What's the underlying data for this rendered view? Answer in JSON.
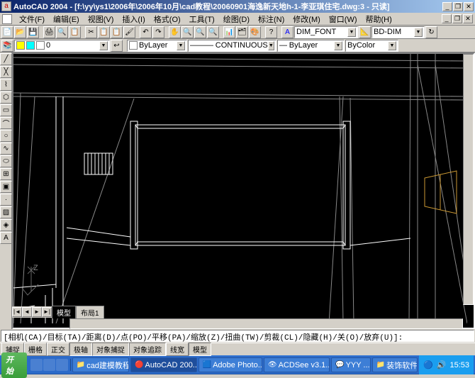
{
  "title": "AutoCAD 2004 - [f:\\yy\\ys1\\2006年\\2006年10月\\cad教程\\20060901海逸新天地h-1-李亚琪住宅.dwg:3 - 只读]",
  "appicon": "a",
  "menu": {
    "file": "文件(F)",
    "edit": "编辑(E)",
    "view": "视图(V)",
    "insert": "插入(I)",
    "format": "格式(O)",
    "tools": "工具(T)",
    "draw": "绘图(D)",
    "dimension": "标注(N)",
    "modify": "修改(M)",
    "window": "窗口(W)",
    "help": "帮助(H)"
  },
  "viewtabs": {
    "model": "模型",
    "layout1": "布局1"
  },
  "cmdline": "[相机(CA)/目标(TA)/距离(D)/点(PO)/平移(PA)/缩放(Z)/扭曲(TW)/剪裁(CL)/隐藏(H)/关(O)/放弃(U)]:",
  "status": {
    "snap": "捕捉",
    "grid": "栅格",
    "ortho": "正交",
    "polar": "极轴",
    "osnap": "对象捕捉",
    "otrack": "对象追踪",
    "lwt": "线宽",
    "model": "模型"
  },
  "task": {
    "start": "开始",
    "t1": "cad建模教程",
    "t2": "AutoCAD 200...",
    "t3": "Adobe Photo...",
    "t4": "ACDSee v3.1...",
    "t5": "YYY ...",
    "t6": "装饰软件",
    "time": "15:53"
  },
  "dropdowns": {
    "layer": "ByLayer",
    "continuous": "CONTINUOUS",
    "bylayer2": "ByLayer",
    "bycolor": "ByColor",
    "dimfont": "DIM_FONT",
    "bddim": "BD-DIM"
  },
  "ucs": "Z"
}
